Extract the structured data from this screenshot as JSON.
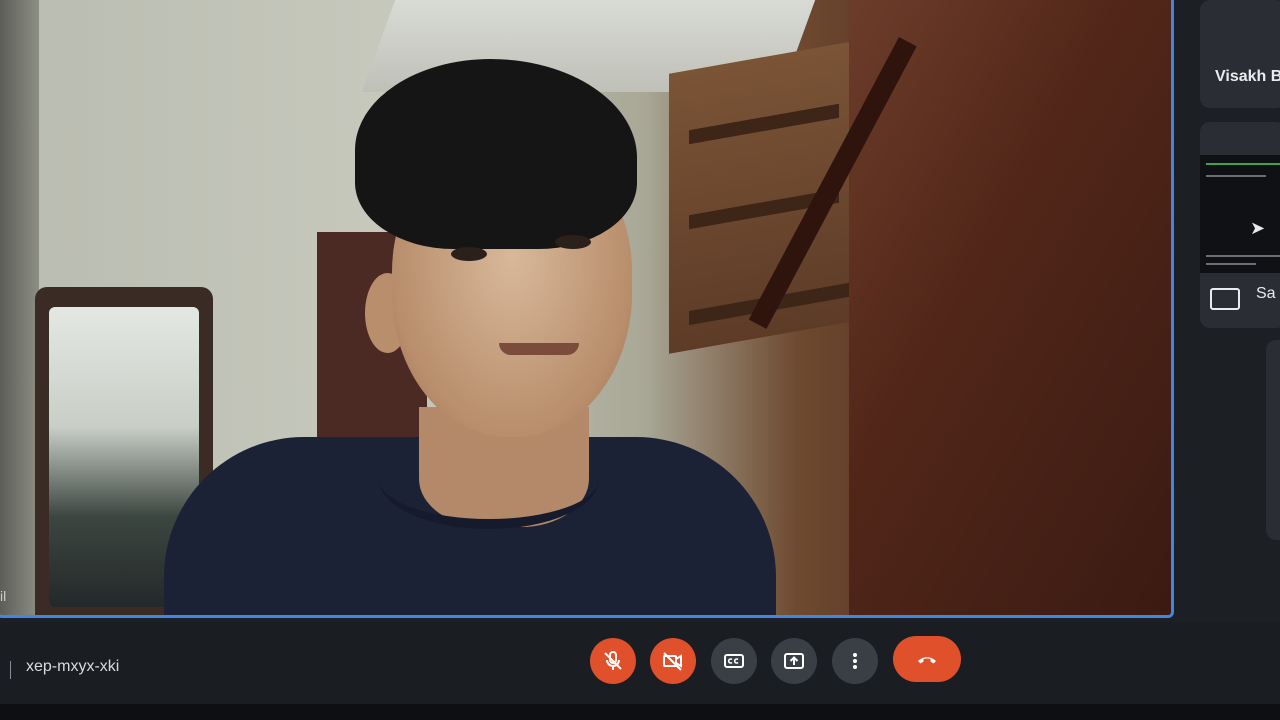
{
  "participants": [
    {
      "name": "Visakh B"
    },
    {
      "name": "Sa"
    }
  ],
  "main_tile": {
    "edge_label": "il"
  },
  "meeting": {
    "code": "xep-mxyx-xki"
  },
  "controls": [
    {
      "name": "microphone",
      "state": "muted",
      "color": "#e0502a",
      "icon": "mic-off-icon"
    },
    {
      "name": "camera",
      "state": "off",
      "color": "#e0502a",
      "icon": "videocam-off-icon"
    },
    {
      "name": "captions",
      "state": "off",
      "color": "#3a3f46",
      "icon": "closed-caption-icon"
    },
    {
      "name": "present",
      "state": "idle",
      "color": "#3a3f46",
      "icon": "present-screen-icon"
    },
    {
      "name": "more-options",
      "state": "idle",
      "color": "#3a3f46",
      "icon": "more-vert-icon"
    },
    {
      "name": "leave-call",
      "state": "idle",
      "color": "#e0502a",
      "icon": "call-end-icon"
    }
  ],
  "colors": {
    "active_speaker_border": "#3f87e6",
    "danger": "#e0502a"
  }
}
